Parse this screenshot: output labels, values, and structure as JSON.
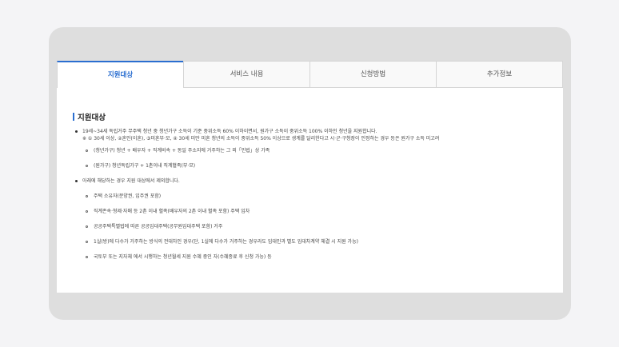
{
  "tabs": [
    {
      "label": "지원대상",
      "active": true
    },
    {
      "label": "서비스 내용",
      "active": false
    },
    {
      "label": "신청방법",
      "active": false
    },
    {
      "label": "추가정보",
      "active": false
    }
  ],
  "section": {
    "title": "지원대상"
  },
  "bullet1": {
    "text": "19세~34세 독립거주 무주택 청년 중 청년가구 소득이 기준 중위소득 60% 이하이면서, 원가구 소득이 중위소득 100% 이하인 청년을 지원합니다.",
    "note": "※ ① 30세 이상, ②혼인(이혼), ③미혼부·모, ④ 30세 미만 미혼 청년의 소득이 중위소득 50% 이상으로 생계를 달리한다고 시·군·구청장이 인정하는 경우 등은 원가구 소득 미고려"
  },
  "sub1": [
    "(청년가구) 청년 + 배우자 + 직계비속 + 동일 주소지에 거주하는 그 외「민법」상 가족",
    "(원가구) 청년독립가구 + 1촌이내 직계혈족(부·모)"
  ],
  "bullet2": {
    "text": "아래에 해당하는 경우 지원 대상에서 제외합니다."
  },
  "sub2": [
    "주택 소유자(분양권, 입주권 포함)",
    "직계존속·형제·자매 등 2촌 이내 혈족(배우자의 2촌 이내 혈족 포함) 주택 임차",
    "공공주택특별법에 따른 공공임대주택(공무원임대주택 포함) 거주",
    "1실(방)에 다수가 거주하는 방식의 전대차인 경우(단, 1실에 다수가 거주하는 경우라도 임대인과 별도 임대차계약 체결 시 지원 가능)",
    "국토부 또는 지자체 에서 시행하는 청년월세 지원 수혜 중인 자(수혜종료 후 신청 가능) 등"
  ],
  "colors": {
    "accent": "#2a6ed0",
    "frame": "#dedede",
    "background": "#f4f4f6"
  }
}
